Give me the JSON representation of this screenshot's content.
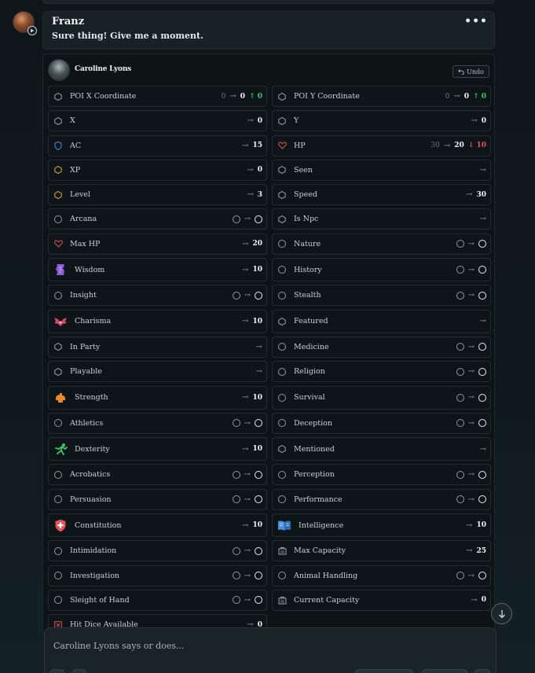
{
  "message": {
    "author": "Franz",
    "text": "Sure thing! Give me a moment.",
    "more": "•••"
  },
  "card": {
    "character_name": "Caroline Lyons",
    "undo_label": "Undo",
    "fields": [
      {
        "label": "POI X Coordinate",
        "icon": "hexagon-icon",
        "icon_color": "#9aa4a8",
        "old": "0",
        "arrow": "→",
        "new": "0",
        "delta": "↑ 0",
        "delta_color": "#3ec46d"
      },
      {
        "label": "POI Y Coordinate",
        "icon": "hexagon-icon",
        "icon_color": "#9aa4a8",
        "old": "0",
        "arrow": "→",
        "new": "0",
        "delta": "↑ 0",
        "delta_color": "#3ec46d"
      },
      {
        "label": "X",
        "icon": "hexagon-icon",
        "icon_color": "#9aa4a8",
        "arrow": "→",
        "new": "0"
      },
      {
        "label": "Y",
        "icon": "hexagon-icon",
        "icon_color": "#9aa4a8",
        "arrow": "→",
        "new": "0"
      },
      {
        "label": "AC",
        "icon": "shield-icon",
        "icon_color": "#4a7fd6",
        "arrow": "→",
        "new": "15"
      },
      {
        "label": "HP",
        "icon": "heart-icon",
        "icon_color": "#e0545a",
        "old": "30",
        "arrow": "→",
        "new": "20",
        "delta": "↓ 10",
        "delta_color": "#e0545a"
      },
      {
        "label": "XP",
        "icon": "hexagon-icon",
        "icon_color": "#d9b23a",
        "arrow": "→",
        "new": "0"
      },
      {
        "label": "Seen",
        "icon": "hexagon-icon",
        "icon_color": "#9aa4a8",
        "arrow": "→"
      },
      {
        "label": "Level",
        "icon": "hexagon-icon",
        "icon_color": "#d9b23a",
        "arrow": "→",
        "new": "3"
      },
      {
        "label": "Speed",
        "icon": "hexagon-icon",
        "icon_color": "#9aa4a8",
        "arrow": "→",
        "new": "30"
      },
      {
        "label": "Arcana",
        "icon": "circle-icon",
        "ring": true,
        "arrow": "→"
      },
      {
        "label": "Is Npc",
        "icon": "hexagon-icon",
        "icon_color": "#9aa4a8",
        "arrow": "→"
      },
      {
        "label": "Max HP",
        "icon": "heart-icon",
        "icon_color": "#e0545a",
        "arrow": "→",
        "new": "20"
      },
      {
        "label": "Nature",
        "icon": "circle-icon",
        "ring": true,
        "arrow": "→"
      },
      {
        "label": "Wisdom",
        "icon": "wisdom-scroll-icon",
        "icon_color": "#8c5cd6",
        "arrow": "→",
        "new": "10",
        "tall": true
      },
      {
        "label": "History",
        "icon": "circle-icon",
        "ring": true,
        "arrow": "→",
        "tall": true
      },
      {
        "label": "Insight",
        "icon": "circle-icon",
        "ring": true,
        "arrow": "→"
      },
      {
        "label": "Stealth",
        "icon": "circle-icon",
        "ring": true,
        "arrow": "→"
      },
      {
        "label": "Charisma",
        "icon": "charisma-wings-icon",
        "icon_color": "#d6456b",
        "arrow": "→",
        "new": "10",
        "tall": true
      },
      {
        "label": "Featured",
        "icon": "hexagon-icon",
        "icon_color": "#9aa4a8",
        "arrow": "→",
        "tall": true
      },
      {
        "label": "In Party",
        "icon": "hexagon-icon",
        "icon_color": "#9aa4a8",
        "arrow": "→"
      },
      {
        "label": "Medicine",
        "icon": "circle-icon",
        "ring": true,
        "arrow": "→"
      },
      {
        "label": "Playable",
        "icon": "hexagon-icon",
        "icon_color": "#9aa4a8",
        "arrow": "→"
      },
      {
        "label": "Religion",
        "icon": "circle-icon",
        "ring": true,
        "arrow": "→"
      },
      {
        "label": "Strength",
        "icon": "strength-arm-icon",
        "icon_color": "#e88a2e",
        "arrow": "→",
        "new": "10",
        "tall": true
      },
      {
        "label": "Survival",
        "icon": "circle-icon",
        "ring": true,
        "arrow": "→",
        "tall": true
      },
      {
        "label": "Athletics",
        "icon": "circle-icon",
        "ring": true,
        "arrow": "→"
      },
      {
        "label": "Deception",
        "icon": "circle-icon",
        "ring": true,
        "arrow": "→"
      },
      {
        "label": "Dexterity",
        "icon": "dexterity-runner-icon",
        "icon_color": "#3ec46d",
        "arrow": "→",
        "new": "10",
        "tall": true
      },
      {
        "label": "Mentioned",
        "icon": "hexagon-icon",
        "icon_color": "#9aa4a8",
        "arrow": "→",
        "tall": true
      },
      {
        "label": "Acrobatics",
        "icon": "circle-icon",
        "ring": true,
        "arrow": "→"
      },
      {
        "label": "Perception",
        "icon": "circle-icon",
        "ring": true,
        "arrow": "→"
      },
      {
        "label": "Persuasion",
        "icon": "circle-icon",
        "ring": true,
        "arrow": "→"
      },
      {
        "label": "Performance",
        "icon": "circle-icon",
        "ring": true,
        "arrow": "→"
      },
      {
        "label": "Constitution",
        "icon": "constitution-shield-icon",
        "icon_color": "#e0545a",
        "arrow": "→",
        "new": "10",
        "tall": true
      },
      {
        "label": "Intelligence",
        "icon": "intelligence-book-icon",
        "icon_color": "#4a90e0",
        "arrow": "→",
        "new": "10",
        "tall": true
      },
      {
        "label": "Intimidation",
        "icon": "circle-icon",
        "ring": true,
        "arrow": "→"
      },
      {
        "label": "Max Capacity",
        "icon": "weight-icon",
        "icon_color": "#9aa4a8",
        "arrow": "→",
        "new": "25"
      },
      {
        "label": "Investigation",
        "icon": "circle-icon",
        "ring": true,
        "arrow": "→"
      },
      {
        "label": "Animal Handling",
        "icon": "circle-icon",
        "ring": true,
        "arrow": "→"
      },
      {
        "label": "Sleight of Hand",
        "icon": "circle-icon",
        "ring": true,
        "arrow": "→"
      },
      {
        "label": "Current Capacity",
        "icon": "weight-icon",
        "icon_color": "#9aa4a8",
        "arrow": "→",
        "new": "0"
      },
      {
        "label": "Hit Dice Available",
        "icon": "dice-icon",
        "icon_color": "#e0545a",
        "arrow": "→",
        "new": "0"
      }
    ]
  },
  "composer": {
    "placeholder": "Caroline Lyons says or does..."
  }
}
